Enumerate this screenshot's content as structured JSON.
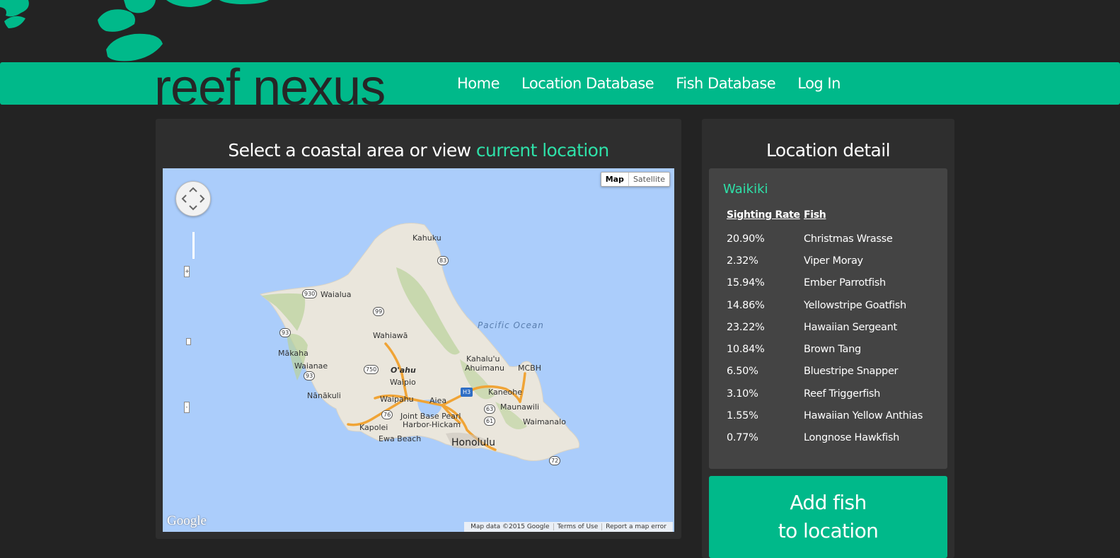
{
  "brand": {
    "logo": "reef nexus",
    "accent": "#00b98a",
    "highlight": "#2ee0a8"
  },
  "nav": {
    "items": [
      "Home",
      "Location Database",
      "Fish Database",
      "Log In"
    ]
  },
  "map_panel": {
    "title_prefix": "Select a coastal area or view ",
    "title_link": "current location",
    "map_types": [
      "Map",
      "Satellite"
    ],
    "google_logo": "Google",
    "attribution": [
      "Map data ©2015 Google",
      "Terms of Use",
      "Report a map error"
    ],
    "labels": {
      "kahuku": "Kahuku",
      "waialua": "Waialua",
      "wahiawa": "Wahiawā",
      "pacific": "Pacific Ocean",
      "makaha": "Mākaha",
      "waianae": "Waianae",
      "oahu": "O'ahu",
      "waipio": "Waipio",
      "kahaluu": "Kahalu'u",
      "ahuimanu": "Ahuimanu",
      "mcbh": "MCBH",
      "nanakuli": "Nānākuli",
      "waipahu": "Waipahu",
      "aiea": "Aiea",
      "kaneohe": "Kaneohe",
      "maunawili": "Maunawili",
      "jbph1": "Joint Base Pearl",
      "jbph2": "Harbor-Hickam",
      "kapolei": "Kapolei",
      "waimanalo": "Waimanalo",
      "ewa": "Ewa Beach",
      "honolulu": "Honolulu"
    },
    "shields": {
      "s83": "83",
      "s930": "930",
      "s99": "99",
      "s93": "93",
      "s750": "750",
      "s93b": "93",
      "sh3": "H3",
      "s63": "63",
      "s76": "76",
      "s61": "61",
      "s72": "72"
    }
  },
  "detail_panel": {
    "title": "Location detail",
    "location_name": "Waikiki",
    "headers": {
      "rate": "Sighting Rate",
      "fish": "Fish"
    },
    "rows": [
      {
        "rate": "20.90%",
        "fish": "Christmas Wrasse"
      },
      {
        "rate": "2.32%",
        "fish": "Viper Moray"
      },
      {
        "rate": "15.94%",
        "fish": "Ember Parrotfish"
      },
      {
        "rate": "14.86%",
        "fish": "Yellowstripe Goatfish"
      },
      {
        "rate": "23.22%",
        "fish": "Hawaiian Sergeant"
      },
      {
        "rate": "10.84%",
        "fish": "Brown Tang"
      },
      {
        "rate": "6.50%",
        "fish": "Bluestripe Snapper"
      },
      {
        "rate": "3.10%",
        "fish": "Reef Triggerfish"
      },
      {
        "rate": "1.55%",
        "fish": "Hawaiian Yellow Anthias"
      },
      {
        "rate": "0.77%",
        "fish": "Longnose Hawkfish"
      }
    ],
    "add_button_line1": "Add fish",
    "add_button_line2": "to location"
  }
}
